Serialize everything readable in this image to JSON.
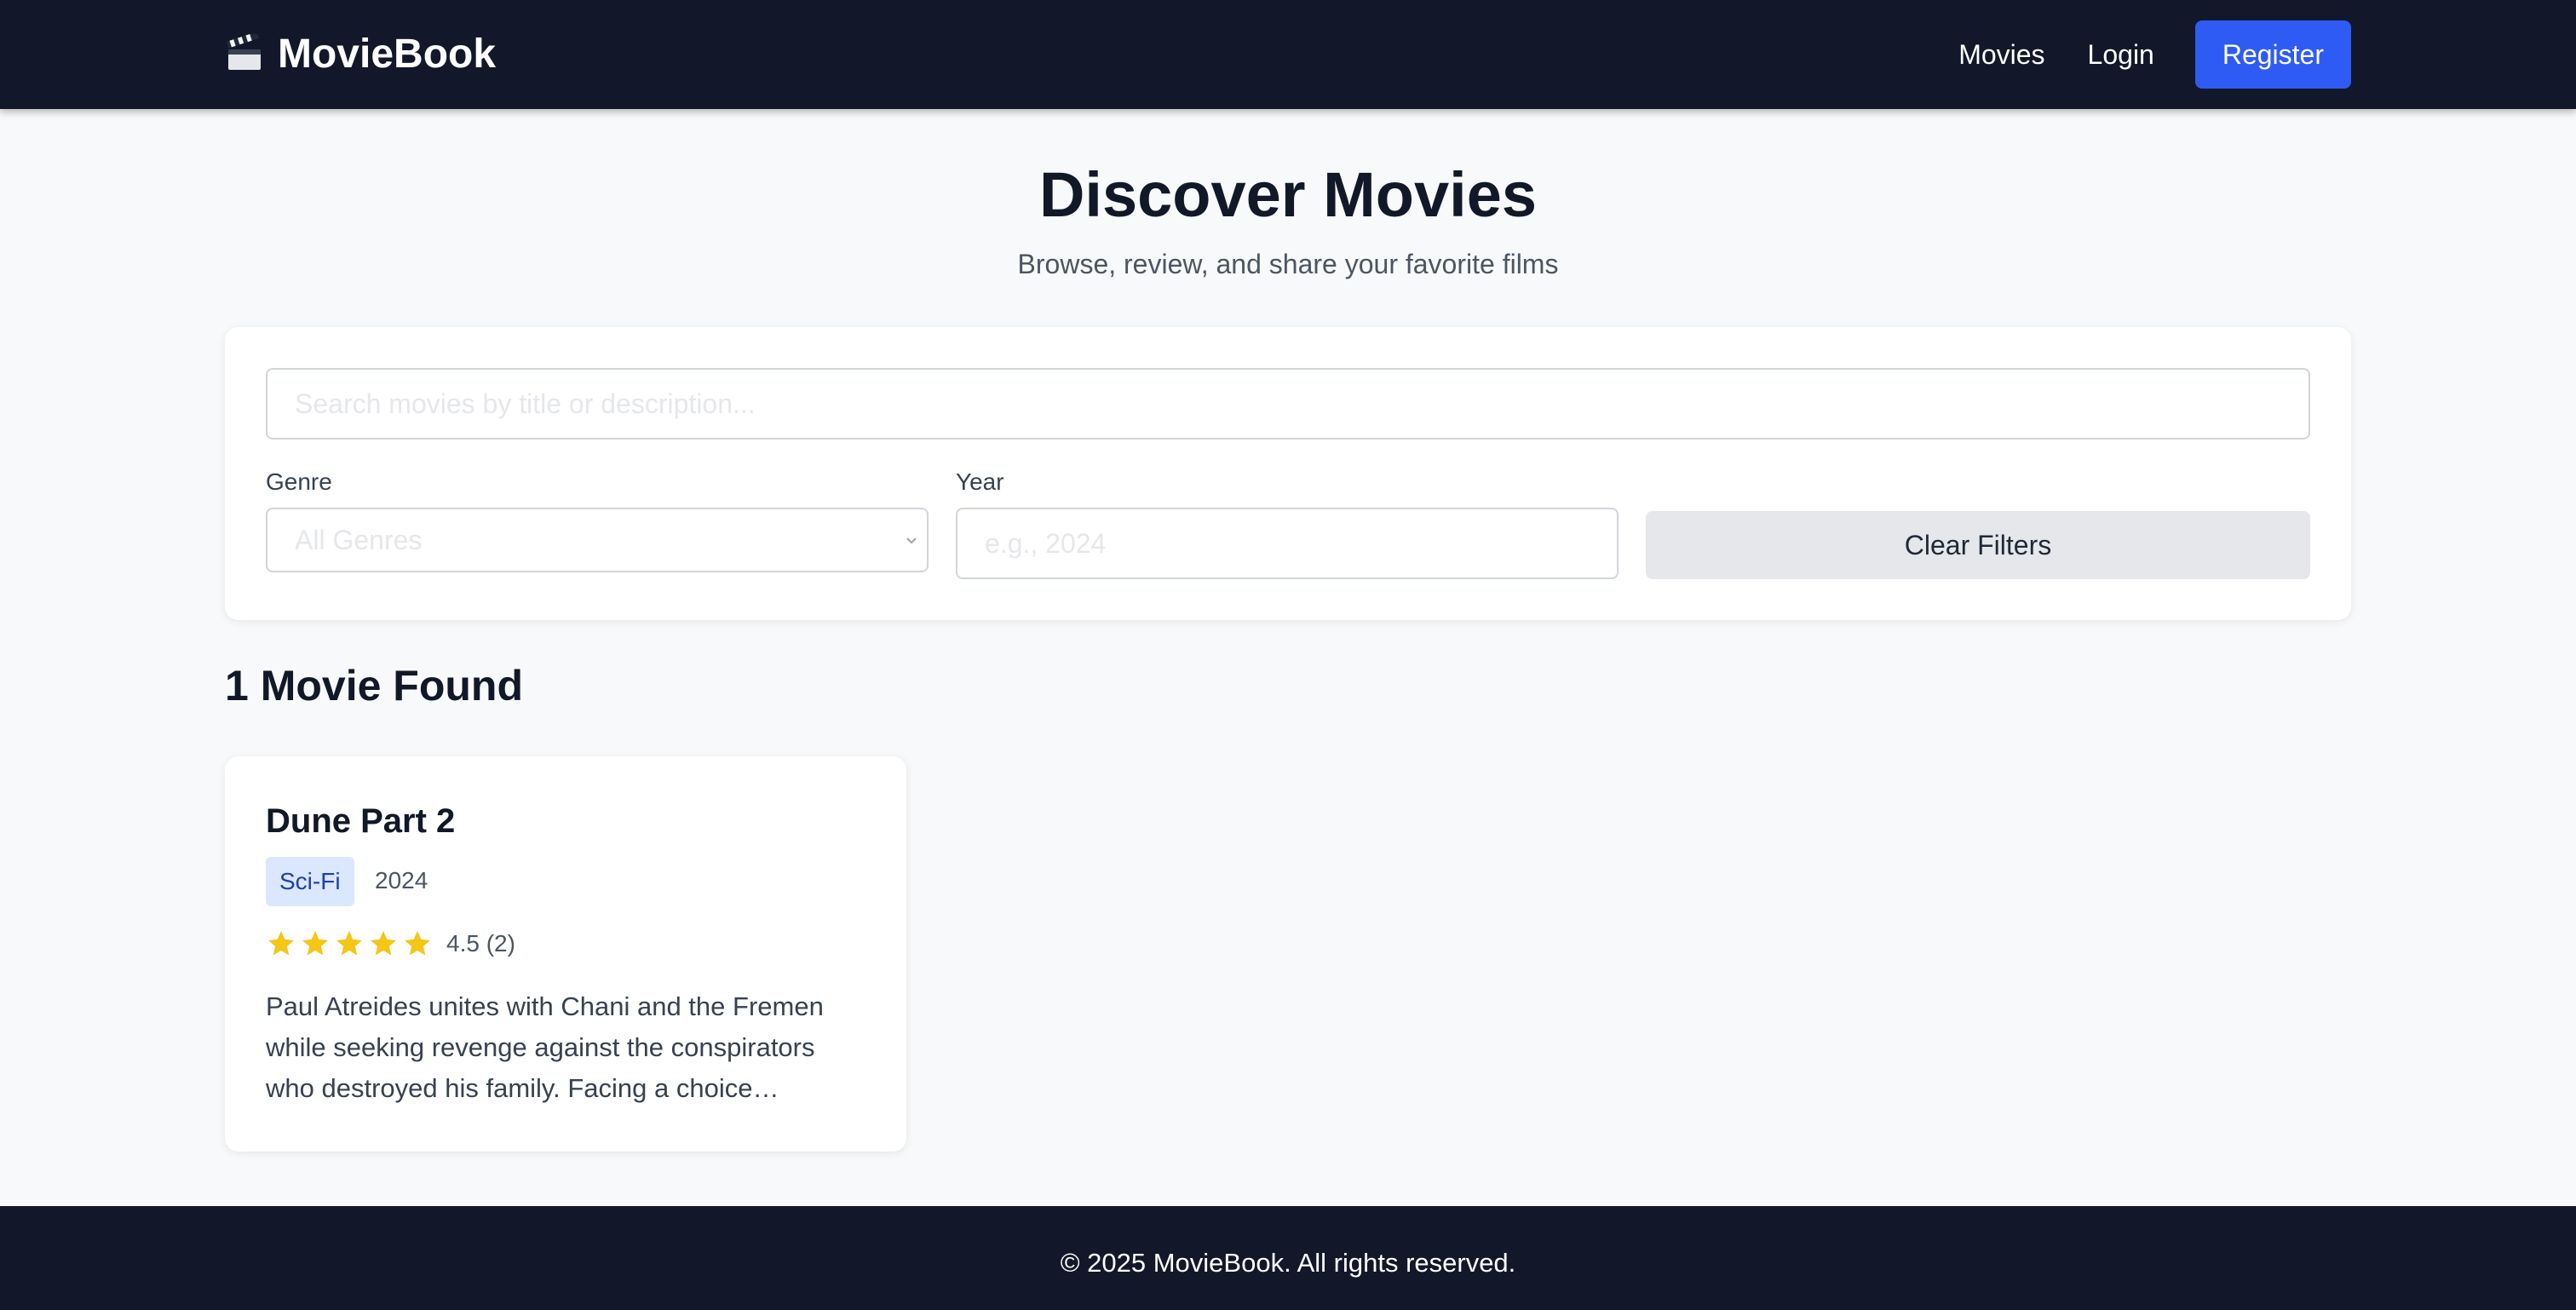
{
  "nav": {
    "brand": "MovieBook",
    "brand_icon": "clapperboard-icon",
    "links": {
      "movies": "Movies",
      "login": "Login",
      "register": "Register"
    }
  },
  "hero": {
    "title": "Discover Movies",
    "subtitle": "Browse, review, and share your favorite films"
  },
  "filters": {
    "search_placeholder": "Search movies by title or description...",
    "genre_label": "Genre",
    "genre_selected": "All Genres",
    "year_label": "Year",
    "year_placeholder": "e.g., 2024",
    "clear_label": "Clear Filters"
  },
  "results": {
    "heading": "1 Movie Found",
    "movies": [
      {
        "title": "Dune Part 2",
        "genre": "Sci-Fi",
        "year": "2024",
        "stars": 5,
        "rating_text": "4.5 (2)",
        "description": "Paul Atreides unites with Chani and the Fremen while seeking revenge against the conspirators who destroyed his family. Facing a choice…"
      }
    ]
  },
  "footer": {
    "text": "© 2025 MovieBook. All rights reserved."
  },
  "colors": {
    "nav_bg": "#121829",
    "accent": "#2f5bf5",
    "star": "#f5c518",
    "badge_bg": "#dbe7fe",
    "badge_text": "#1e40af"
  }
}
